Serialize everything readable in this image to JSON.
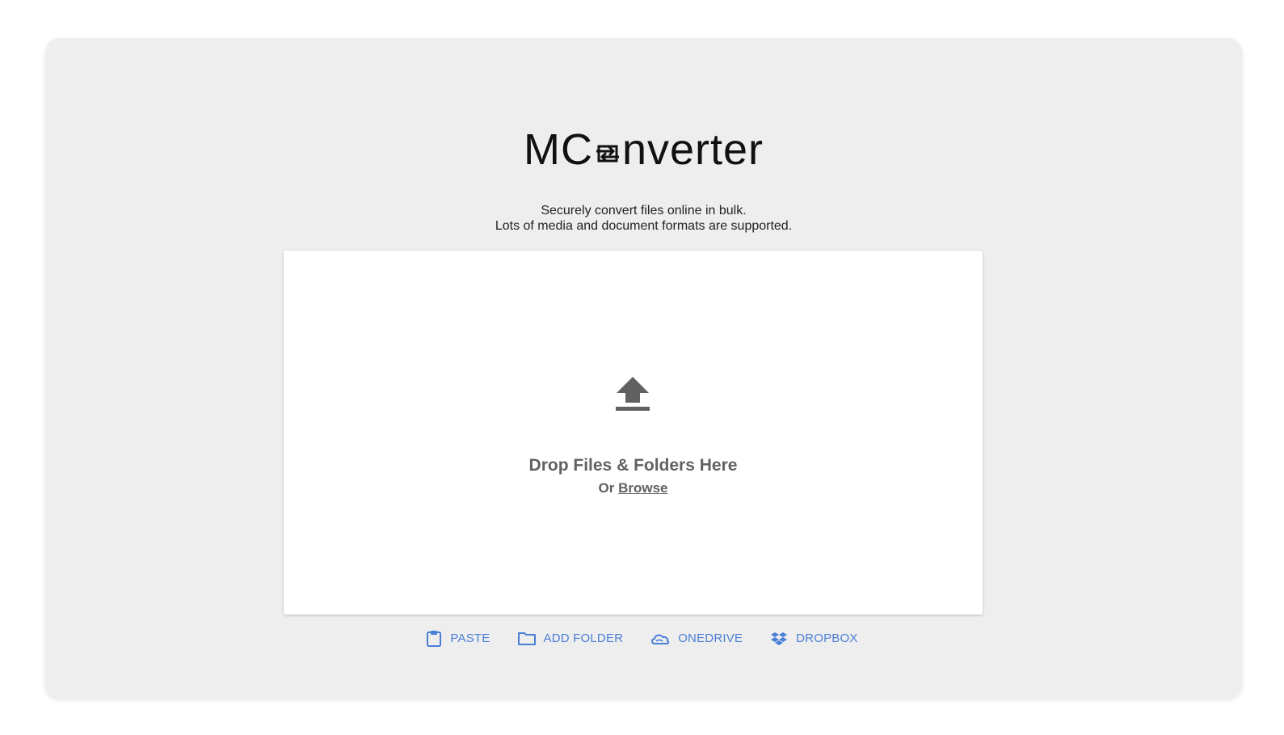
{
  "logo": {
    "part1": "MC",
    "part2": "nverter"
  },
  "tagline": {
    "line1": "Securely convert files online in bulk.",
    "line2": "Lots of media and document formats are supported."
  },
  "dropzone": {
    "title": "Drop Files & Folders Here",
    "or_label": "Or",
    "browse_label": "Browse"
  },
  "actions": [
    {
      "label": "PASTE",
      "icon": "clipboard-icon"
    },
    {
      "label": "ADD FOLDER",
      "icon": "folder-icon"
    },
    {
      "label": "ONEDRIVE",
      "icon": "onedrive-icon"
    },
    {
      "label": "DROPBOX",
      "icon": "dropbox-icon"
    }
  ],
  "colors": {
    "accent": "#4a7fd6",
    "card_bg": "#eeeeee",
    "dropzone_text": "#616161"
  }
}
